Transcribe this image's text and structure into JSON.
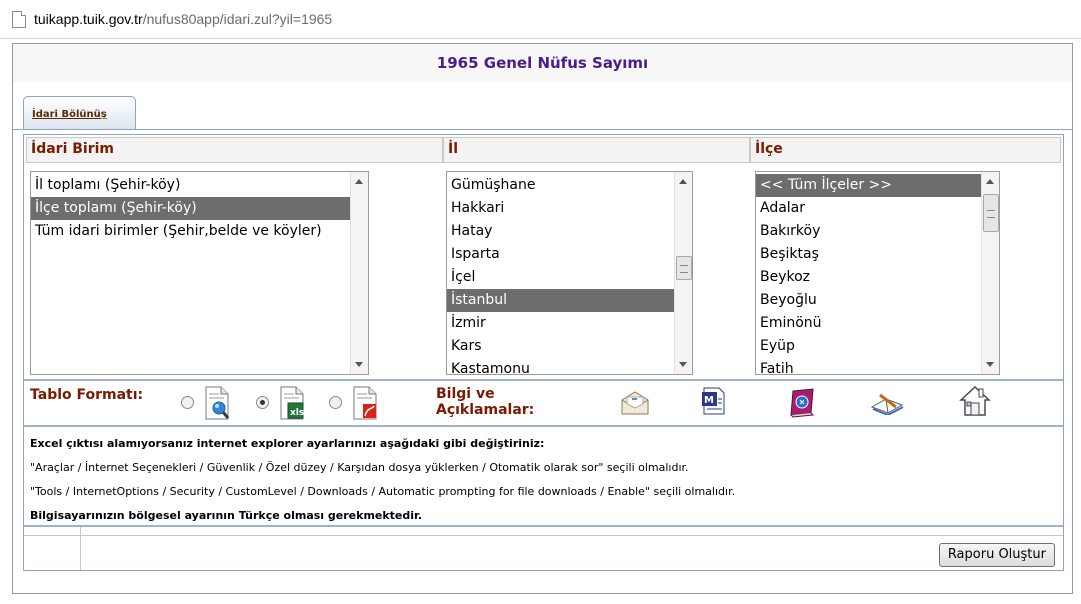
{
  "browser": {
    "url_host": "tuikapp.tuik.gov.tr",
    "url_path": "/nufus80app/idari.zul?yil=1965"
  },
  "page": {
    "title": "1965 Genel Nüfus Sayımı"
  },
  "tabs": [
    {
      "label": "İdari Bölünüş"
    }
  ],
  "columns": {
    "idari_birim": "İdari Birim",
    "il": "İl",
    "ilce": "İlçe"
  },
  "idari_list": {
    "items": [
      "İl toplamı (Şehir-köy)",
      "İlçe toplamı (Şehir-köy)",
      "Tüm idari birimler (Şehir,belde ve köyler)"
    ],
    "selected": "İlçe toplamı (Şehir-köy)"
  },
  "il_list": {
    "items": [
      "Gümüşhane",
      "Hakkari",
      "Hatay",
      "Isparta",
      "İçel",
      "İstanbul",
      "İzmir",
      "Kars",
      "Kastamonu"
    ],
    "selected": "İstanbul"
  },
  "ilce_list": {
    "items": [
      "<< Tüm İlçeler >>",
      "Adalar",
      "Bakırköy",
      "Beşiktaş",
      "Beykoz",
      "Beyoğlu",
      "Eminönü",
      "Eyüp",
      "Fatih"
    ],
    "selected": "<< Tüm İlçeler >>"
  },
  "format": {
    "label": "Tablo Formatı:",
    "options": [
      "preview",
      "excel",
      "pdf"
    ],
    "selected": "excel"
  },
  "bilgi": {
    "label_line1": "Bilgi ve",
    "label_line2": "Açıklamalar:",
    "icons": [
      "envelope-icon",
      "word-doc-icon",
      "help-book-icon",
      "open-book-icon",
      "home-icon"
    ]
  },
  "info": {
    "line1": "Excel çıktısı alamıyorsanız internet explorer ayarlarınızı aşağıdaki gibi değiştiriniz:",
    "line2": "\"Araçlar / İnternet Seçenekleri / Güvenlik / Özel düzey / Karşıdan dosya yüklerken / Otomatik olarak sor\" seçili olmalıdır.",
    "line3": "\"Tools / InternetOptions / Security / CustomLevel / Downloads / Automatic prompting for file downloads / Enable\" seçili olmalıdır.",
    "line4": "Bilgisayarınızın bölgesel ayarının Türkçe olması gerekmektedir."
  },
  "actions": {
    "report_button": "Raporu Oluştur"
  }
}
